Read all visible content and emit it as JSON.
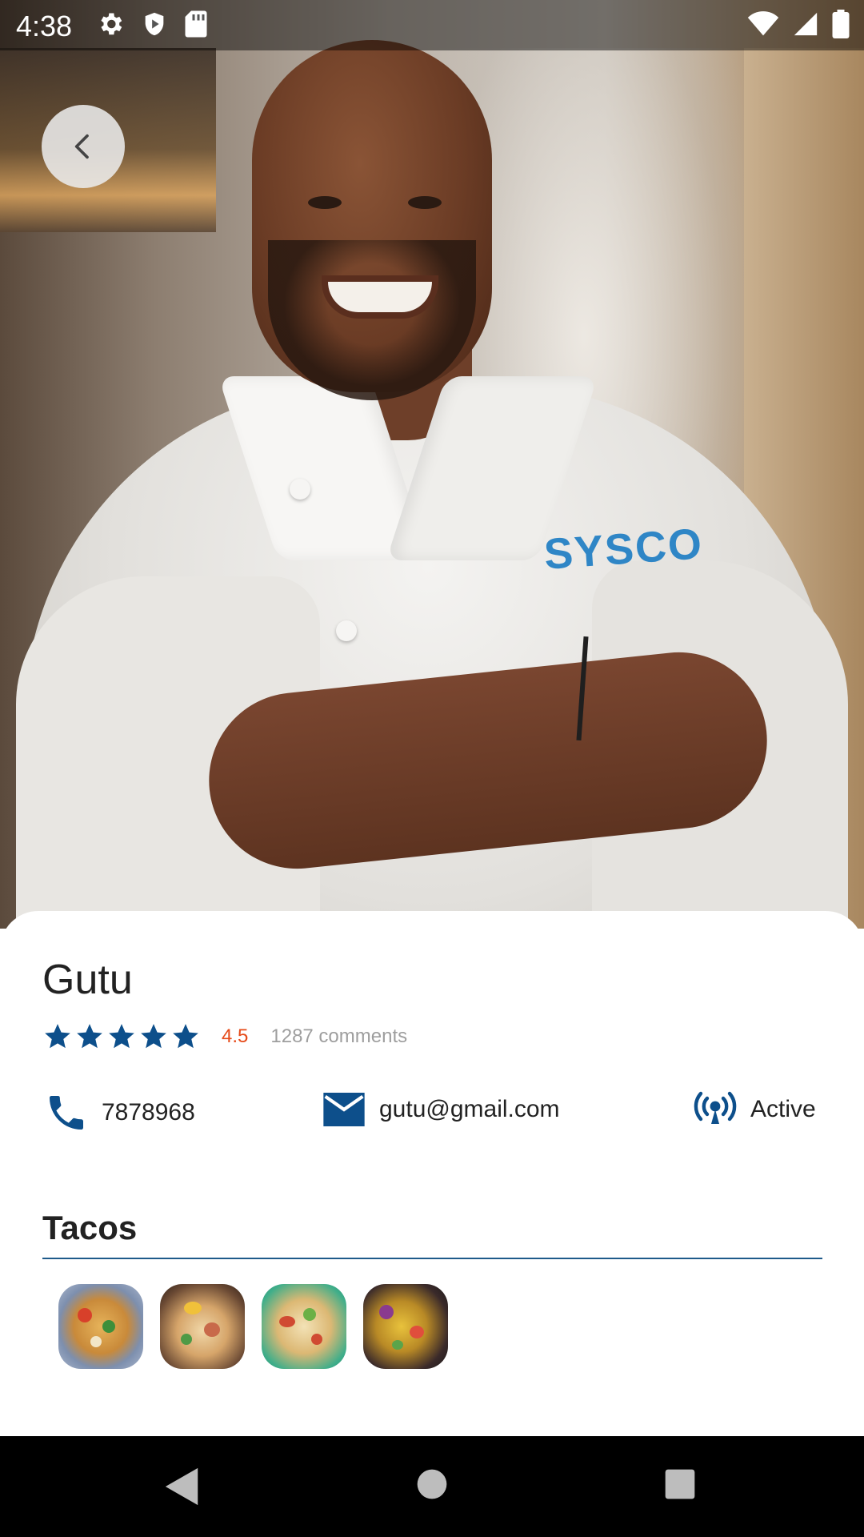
{
  "status_bar": {
    "time": "4:38",
    "left_icons": [
      "gear-icon",
      "shield-icon",
      "sd-card-icon"
    ],
    "right_icons": [
      "wifi-icon",
      "signal-icon",
      "battery-icon"
    ]
  },
  "hero": {
    "shirt_logo": "SYSCO"
  },
  "profile": {
    "name": "Gutu",
    "stars": 5,
    "rating": "4.5",
    "comments": "1287 comments",
    "phone": "7878968",
    "email": "gutu@gmail.com",
    "status": "Active"
  },
  "menu": {
    "title": "Tacos",
    "thumbnail_count": 4
  },
  "colors": {
    "accent": "#0d4f8b",
    "rating": "#e64a19",
    "muted": "#9e9e9e",
    "divider": "#1e5a8a"
  }
}
